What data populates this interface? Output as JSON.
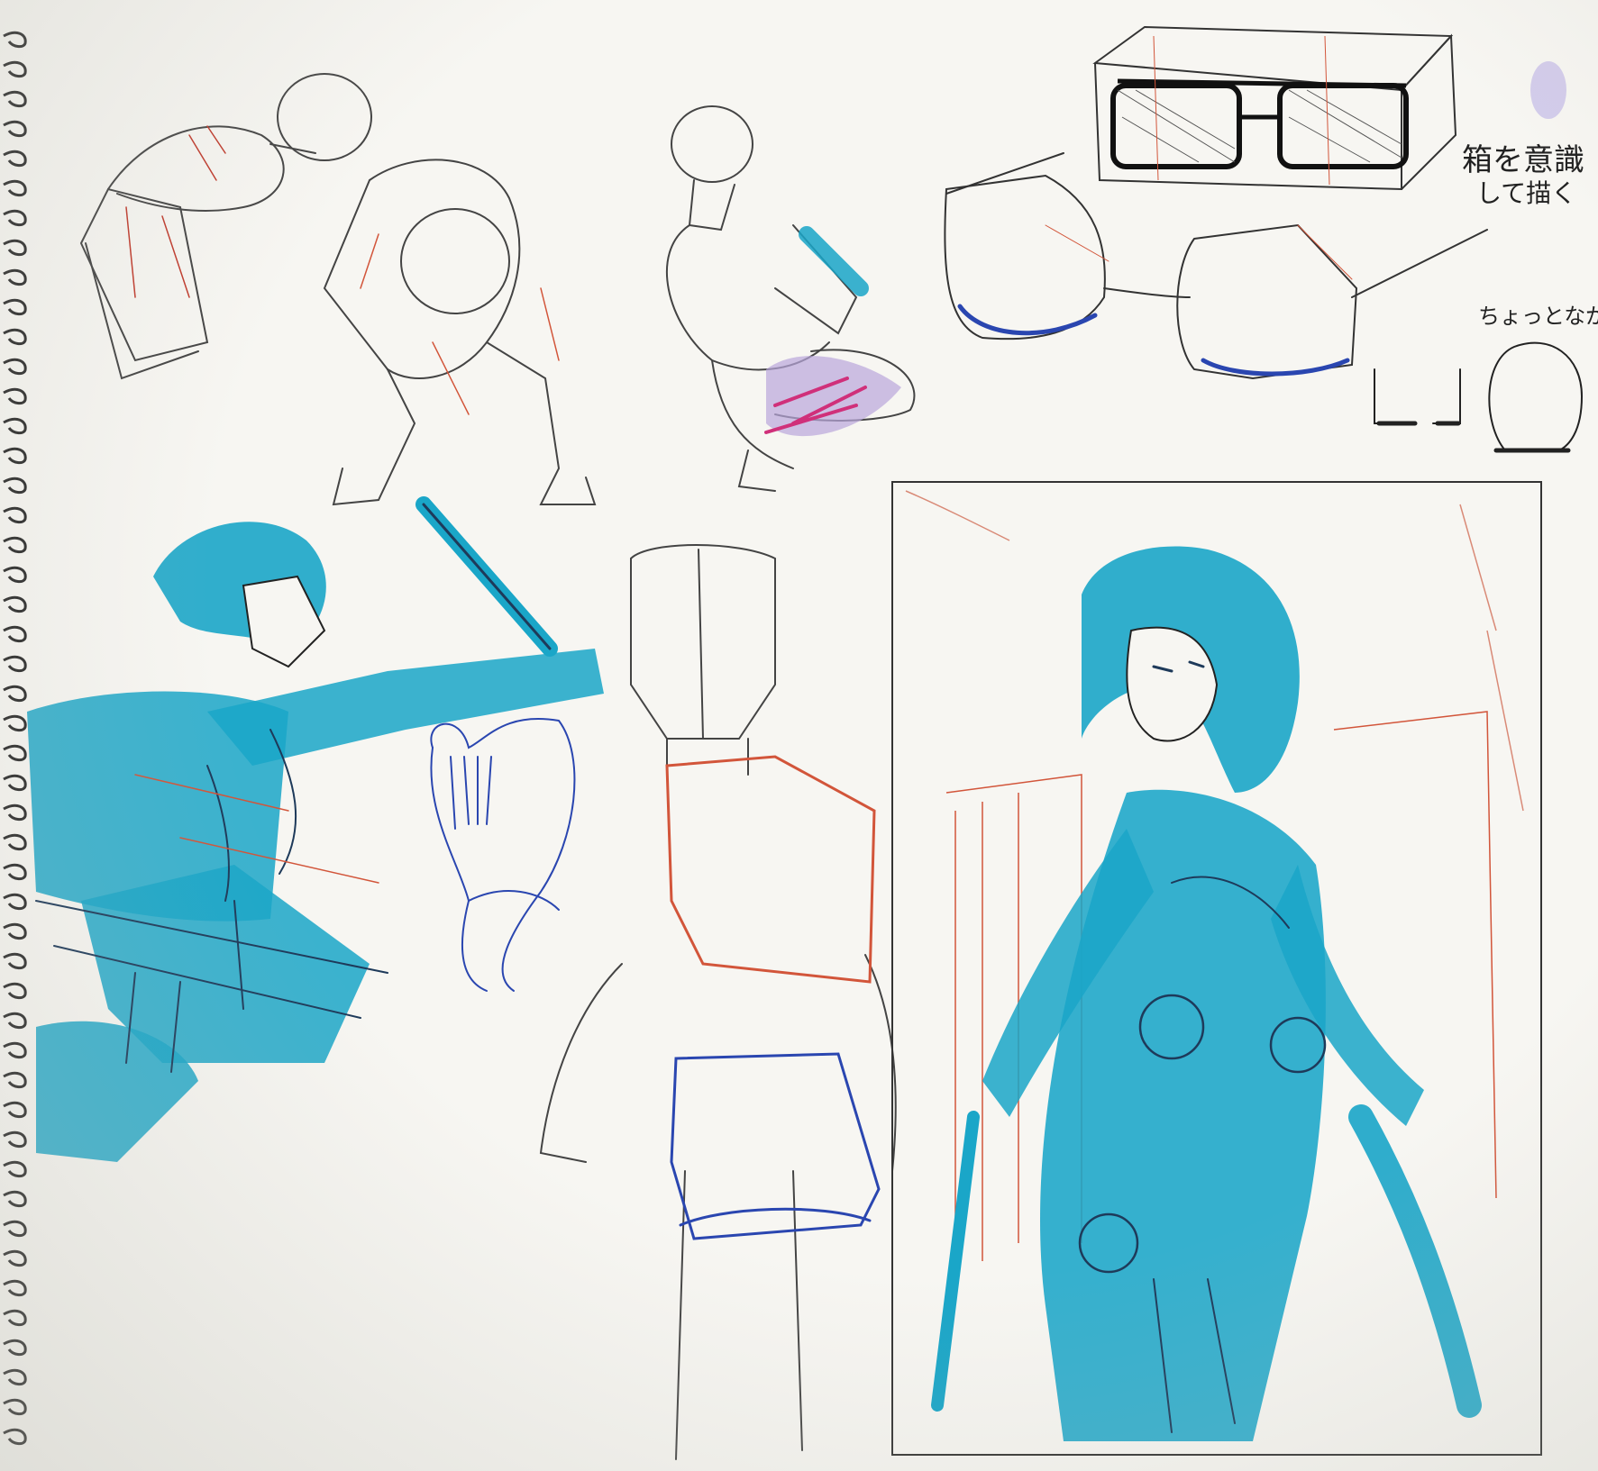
{
  "annotations": {
    "note_box_line1": "箱を意識",
    "note_box_line2": "して描く",
    "note_small": "ちょっとながる"
  },
  "colors": {
    "paper": "#f7f6f2",
    "pencil": "#3a3a3a",
    "cyan_marker": "#1aa6c8",
    "red_pencil": "#d2553a",
    "blue_pen": "#2a46b0",
    "magenta_marker": "#d0307a",
    "lavender": "#b9a6dc"
  },
  "icons": {
    "spiral": "spiral-binding"
  }
}
